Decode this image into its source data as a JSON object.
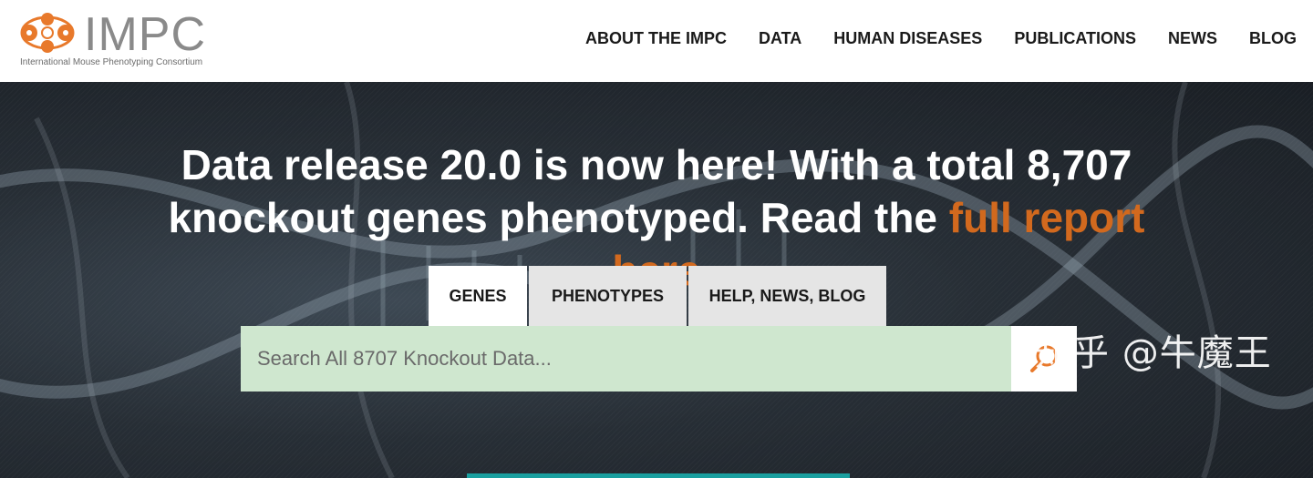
{
  "header": {
    "logo_title": "IMPC",
    "logo_subtitle": "International Mouse Phenotyping Consortium",
    "brand_color": "#e8792b",
    "nav": [
      {
        "label": "ABOUT THE IMPC"
      },
      {
        "label": "DATA"
      },
      {
        "label": "HUMAN DISEASES"
      },
      {
        "label": "PUBLICATIONS"
      },
      {
        "label": "NEWS"
      },
      {
        "label": "BLOG"
      }
    ]
  },
  "hero": {
    "headline_text": "Data release 20.0 is now here! With a total 8,707 knockout genes phenotyped. Read the",
    "headline_link": "full report here",
    "link_color": "#d2691e"
  },
  "search": {
    "tabs": [
      {
        "label": "GENES",
        "active": true
      },
      {
        "label": "PHENOTYPES",
        "active": false
      },
      {
        "label": "HELP, NEWS, BLOG",
        "active": false
      }
    ],
    "placeholder": "Search All 8707 Knockout Data...",
    "button_icon": "search-icon",
    "field_color": "#cfe7cf"
  },
  "watermark": "知乎 @牛魔王"
}
